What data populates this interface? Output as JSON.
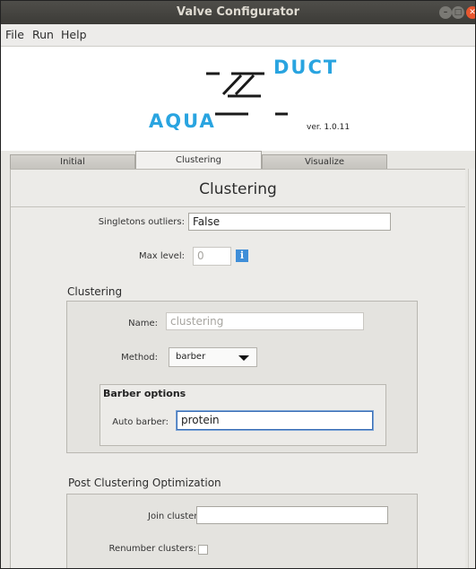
{
  "window": {
    "title": "Valve Configurator"
  },
  "menu": {
    "items": [
      "File",
      "Run",
      "Help"
    ]
  },
  "banner": {
    "logo_left": "AQUA",
    "logo_right": "DUCT",
    "version": "ver. 1.0.11"
  },
  "tabs": [
    {
      "label": "Initial",
      "active": false
    },
    {
      "label": "Clustering",
      "active": true
    },
    {
      "label": "Visualize",
      "active": false
    }
  ],
  "page": {
    "title": "Clustering",
    "singletons_outliers": {
      "label": "Singletons outliers:",
      "value": "False"
    },
    "max_level": {
      "label": "Max level:",
      "value": "0"
    },
    "clustering_section": {
      "title": "Clustering",
      "name": {
        "label": "Name:",
        "value": "clustering"
      },
      "method": {
        "label": "Method:",
        "value": "barber"
      },
      "barber_options": {
        "title": "Barber options",
        "auto_barber": {
          "label": "Auto barber:",
          "value": "protein"
        }
      }
    },
    "post_clustering": {
      "title": "Post Clustering Optimization",
      "join_clusters": {
        "label": "Join clusters:",
        "value": ""
      },
      "renumber_clusters": {
        "label": "Renumber clusters:",
        "checked": false
      }
    }
  },
  "colors": {
    "accent": "#29a4e0",
    "logo_dark": "#1a1a1a",
    "titlebar": "#3c3b37",
    "close": "#e8572f"
  }
}
